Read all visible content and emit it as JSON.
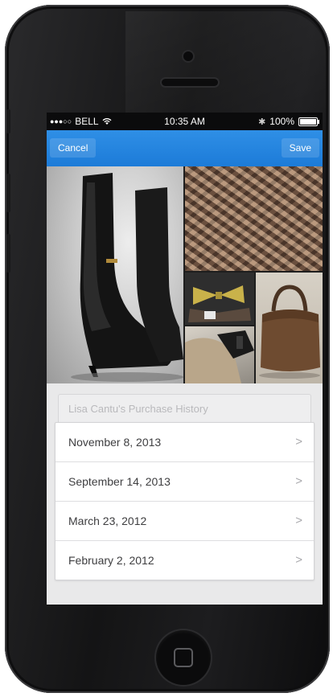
{
  "status_bar": {
    "carrier": "BELL",
    "time": "10:35 AM",
    "battery": "100%"
  },
  "nav": {
    "cancel_label": "Cancel",
    "save_label": "Save"
  },
  "collage": {
    "images": [
      "boots-photo",
      "scarf-photo",
      "bow-tie-photo",
      "coat-collar-photo",
      "handbag-photo"
    ]
  },
  "purchase_history": {
    "title": "Lisa Cantu's Purchase History",
    "items": [
      {
        "date": "November 8, 2013"
      },
      {
        "date": "September 14, 2013"
      },
      {
        "date": "March 23, 2012"
      },
      {
        "date": "February 2, 2012"
      }
    ]
  },
  "colors": {
    "nav_blue": "#1c7bd8",
    "screen_background": "#e9e9ea"
  }
}
